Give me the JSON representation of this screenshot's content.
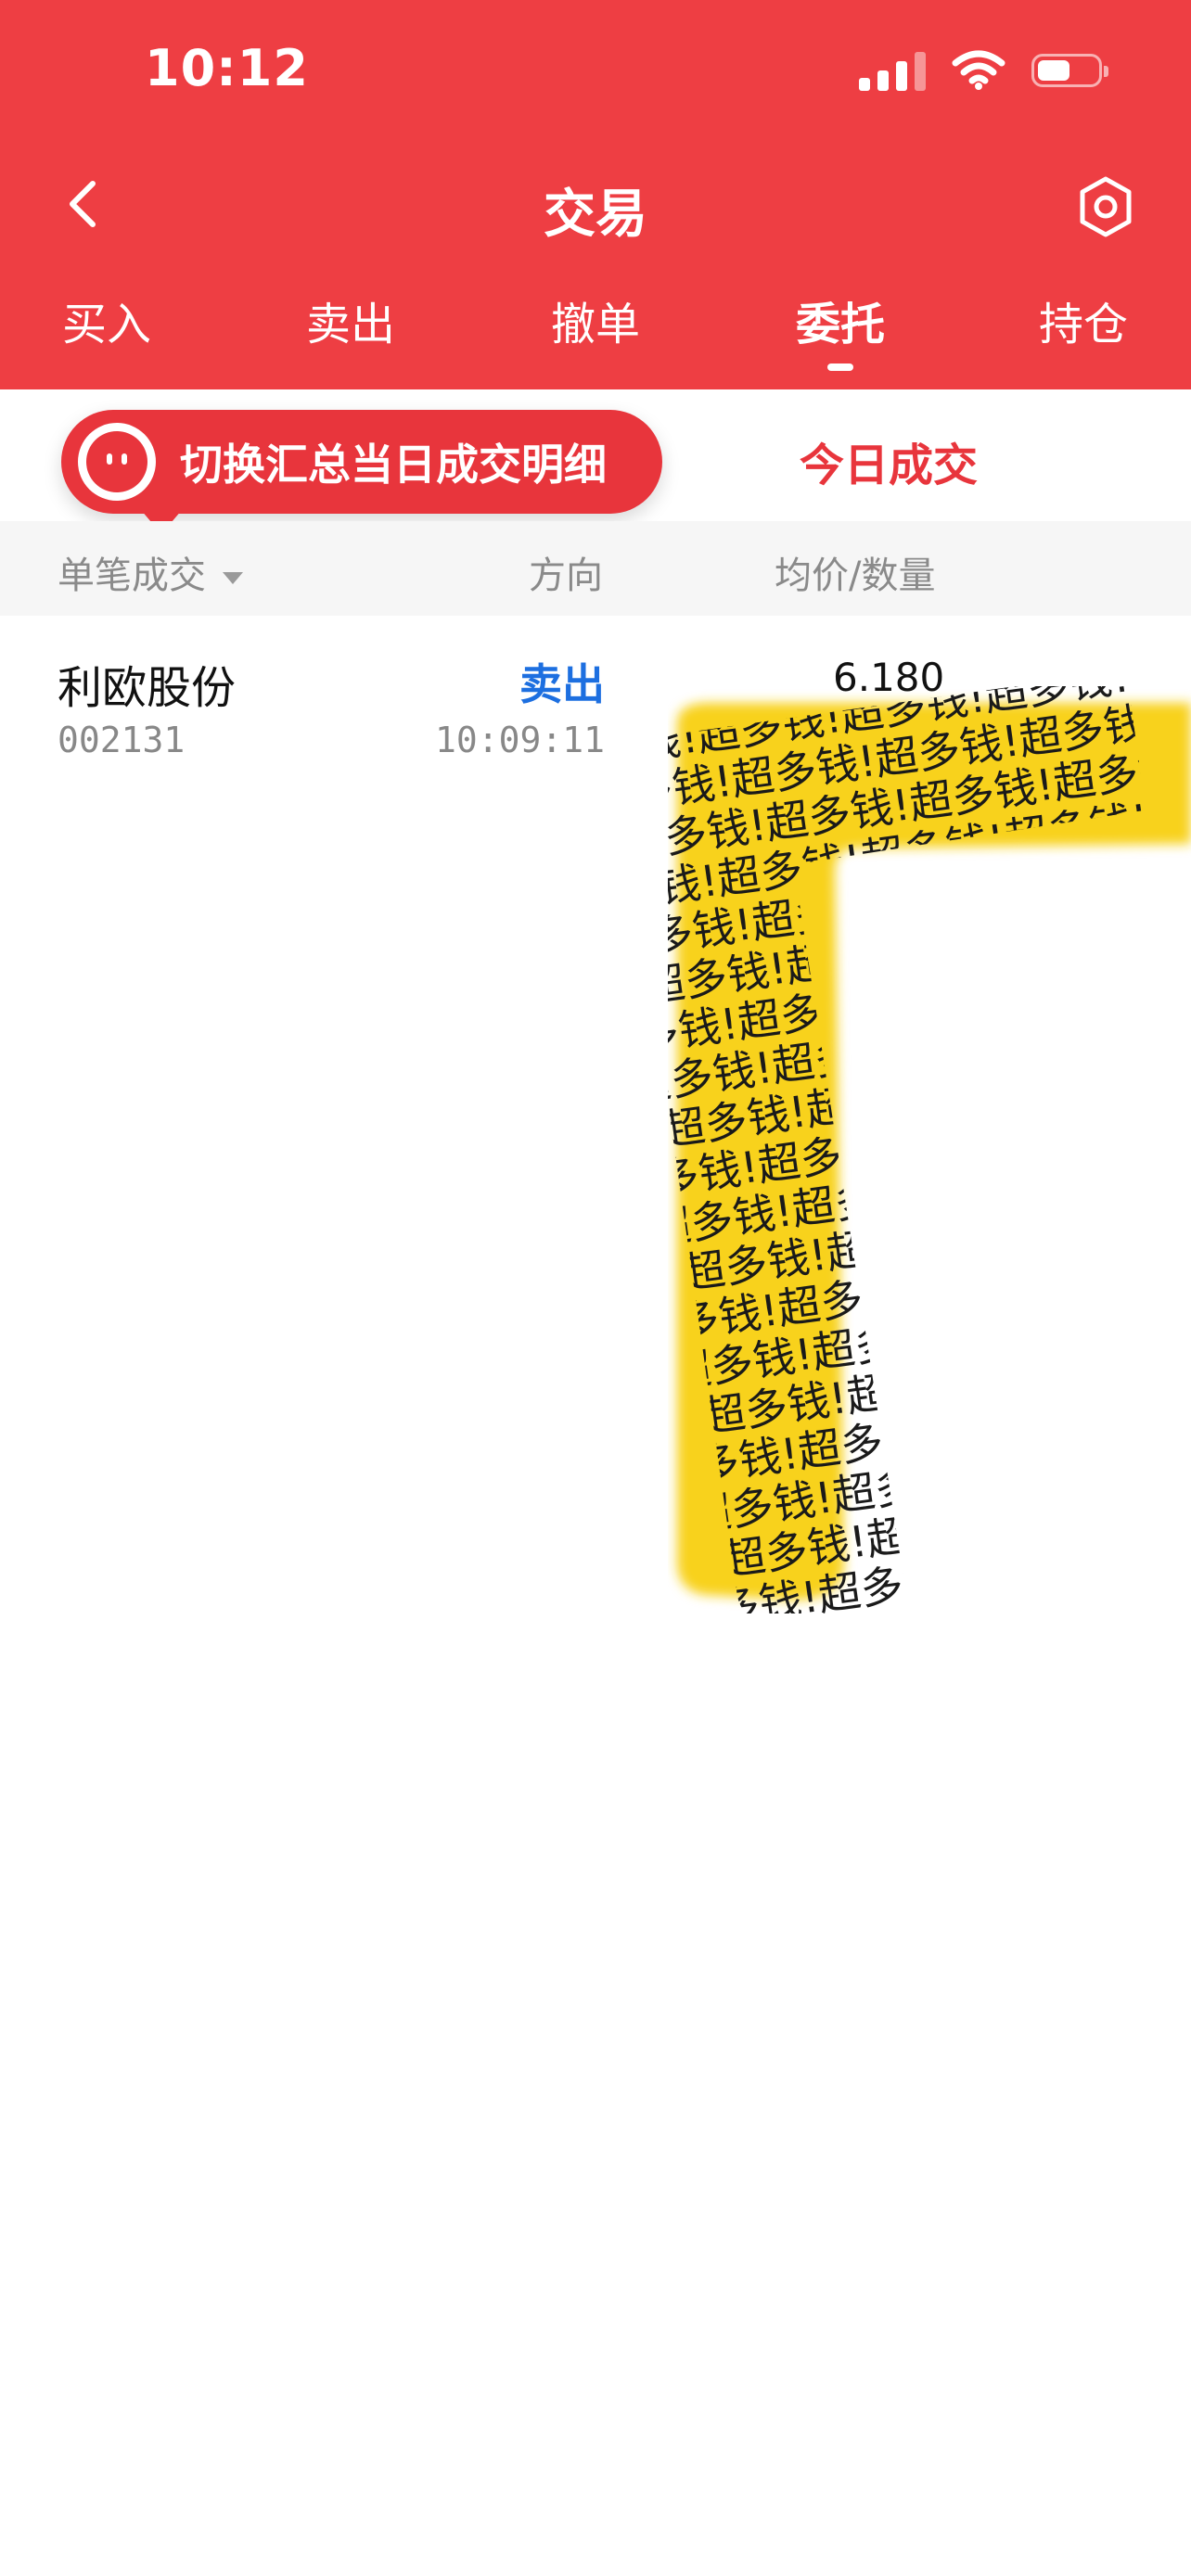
{
  "status_bar": {
    "time": "10:12"
  },
  "header": {
    "title": "交易"
  },
  "tabs": [
    {
      "label": "买入"
    },
    {
      "label": "卖出"
    },
    {
      "label": "撤单"
    },
    {
      "label": "委托",
      "active": true
    },
    {
      "label": "持仓"
    }
  ],
  "subbar": {
    "tooltip": "切换汇总当日成交明细",
    "today_tab": "今日成交"
  },
  "columns": {
    "col1": "单笔成交",
    "col2": "方向",
    "col3": "均价/数量"
  },
  "trades": [
    {
      "name": "利欧股份",
      "code": "002131",
      "direction": "卖出",
      "time": "10:09:11",
      "price": "6.180"
    }
  ],
  "sticker": {
    "text": "超多钱!",
    "color": "#f8d21c"
  },
  "colors": {
    "brand": "#ee3e43",
    "sell": "#1d6fe0"
  }
}
